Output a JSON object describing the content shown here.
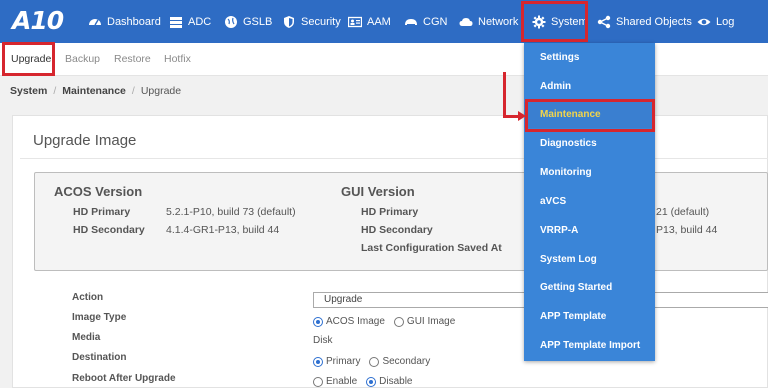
{
  "app": {
    "logo": "A10"
  },
  "nav": {
    "items": [
      {
        "label": "Dashboard",
        "icon": "dashboard-icon"
      },
      {
        "label": "ADC",
        "icon": "adc-icon"
      },
      {
        "label": "GSLB",
        "icon": "globe-icon"
      },
      {
        "label": "Security",
        "icon": "shield-icon"
      },
      {
        "label": "AAM",
        "icon": "id-card-icon"
      },
      {
        "label": "CGN",
        "icon": "cgn-icon"
      },
      {
        "label": "Network",
        "icon": "cloud-icon"
      },
      {
        "label": "System",
        "icon": "gear-icon"
      },
      {
        "label": "Shared Objects",
        "icon": "share-icon"
      },
      {
        "label": "Log",
        "icon": "eye-icon"
      }
    ]
  },
  "subtabs": [
    "Upgrade",
    "Backup",
    "Restore",
    "Hotfix"
  ],
  "breadcrumb": [
    "System",
    "Maintenance",
    "Upgrade"
  ],
  "panel": {
    "title": "Upgrade Image",
    "acos": {
      "title": "ACOS Version",
      "hd_primary_label": "HD Primary",
      "hd_primary_value": "5.2.1-P10, build 73 (default)",
      "hd_secondary_label": "HD Secondary",
      "hd_secondary_value": "4.1.4-GR1-P13, build 44"
    },
    "gui": {
      "title": "GUI Version",
      "hd_primary_label": "HD Primary",
      "hd_primary_value_partial": "21 (default)",
      "hd_secondary_label": "HD Secondary",
      "hd_secondary_value_partial": "P13, build 44",
      "last_saved_label": "Last Configuration Saved At"
    }
  },
  "form": {
    "action_label": "Action",
    "action_value": "Upgrade",
    "image_type_label": "Image Type",
    "image_type_options": [
      "ACOS Image",
      "GUI Image"
    ],
    "media_label": "Media",
    "media_value": "Disk",
    "destination_label": "Destination",
    "destination_options": [
      "Primary",
      "Secondary"
    ],
    "reboot_label": "Reboot After Upgrade",
    "reboot_options": [
      "Enable",
      "Disable"
    ]
  },
  "system_menu": {
    "items": [
      "Settings",
      "Admin",
      "Maintenance",
      "Diagnostics",
      "Monitoring",
      "aVCS",
      "VRRP-A",
      "System Log",
      "Getting Started",
      "APP Template",
      "APP Template Import"
    ],
    "selected": "Maintenance"
  },
  "colors": {
    "nav_bg": "#2e6cc4",
    "menu_bg": "#3a85d8",
    "menu_selected_text": "#f3d54a",
    "highlight": "#d6262e",
    "radio_accent": "#2d6fd0"
  }
}
